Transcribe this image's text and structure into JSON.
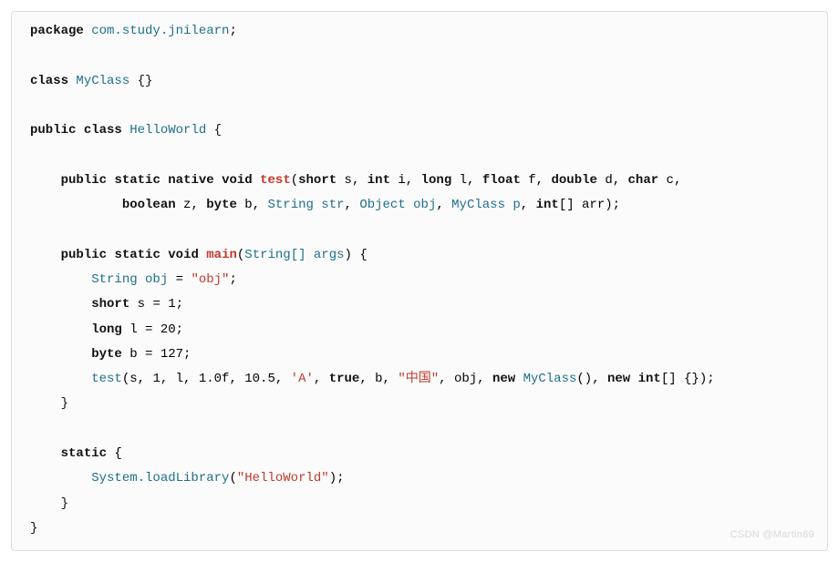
{
  "code": {
    "l1_kw1": "package",
    "l1_pkg": "com.study.jnilearn",
    "l1_semi": ";",
    "l3_kw1": "class",
    "l3_name": "MyClass",
    "l3_braces": "{}",
    "l5_kw1": "public",
    "l5_kw2": "class",
    "l5_name": "HelloWorld",
    "l5_ob": "{",
    "l7_ind": "    ",
    "l7_kw1": "public",
    "l7_kw2": "static",
    "l7_kw3": "native",
    "l7_kw4": "void",
    "l7_fn": "test",
    "l7_op": "(",
    "l7_t1": "short",
    "l7_v1": "s",
    "l7_c1": ", ",
    "l7_t2": "int",
    "l7_v2": "i",
    "l7_c2": ", ",
    "l7_t3": "long",
    "l7_v3": "l",
    "l7_c3": ", ",
    "l7_t4": "float",
    "l7_v4": "f",
    "l7_c4": ", ",
    "l7_t5": "double",
    "l7_v5": "d",
    "l7_c5": ", ",
    "l7_t6": "char",
    "l7_v6": "c",
    "l7_c6": ",",
    "l8_ind": "            ",
    "l8_t1": "boolean",
    "l8_v1": "z",
    "l8_c1": ", ",
    "l8_t2": "byte",
    "l8_v2": "b",
    "l8_c2": ", ",
    "l8_t3": "String str",
    "l8_c3": ", ",
    "l8_t4": "Object obj",
    "l8_c4": ", ",
    "l8_t5": "MyClass p",
    "l8_c5": ", ",
    "l8_t6": "int",
    "l8_arr": "[] arr",
    "l8_cp": ");",
    "l10_ind": "    ",
    "l10_kw1": "public",
    "l10_kw2": "static",
    "l10_kw3": "void",
    "l10_fn": "main",
    "l10_op": "(",
    "l10_arg": "String[] args",
    "l10_cp": ") {",
    "l11_ind": "        ",
    "l11_type": "String obj",
    "l11_eq": " = ",
    "l11_str": "\"obj\"",
    "l11_semi": ";",
    "l12_ind": "        ",
    "l12_kw": "short",
    "l12_v": " s = 1;",
    "l13_ind": "        ",
    "l13_kw": "long",
    "l13_v": " l = 20;",
    "l14_ind": "        ",
    "l14_kw": "byte",
    "l14_v": " b = 127;",
    "l15_ind": "        ",
    "l15_call": "test",
    "l15_op": "(",
    "l15_a1": "s, 1, l, 1.0f, 10.5, ",
    "l15_char": "'A'",
    "l15_c1": ", ",
    "l15_true": "true",
    "l15_c2": ", b, ",
    "l15_str": "\"中国\"",
    "l15_c3": ", obj, ",
    "l15_new1": "new",
    "l15_mc": " MyClass",
    "l15_mcp": "(), ",
    "l15_new2": "new",
    "l15_int": " int",
    "l15_tail": "[] {});",
    "l16_ind": "    ",
    "l16_cb": "}",
    "l18_ind": "    ",
    "l18_kw": "static",
    "l18_ob": " {",
    "l19_ind": "        ",
    "l19_call": "System.loadLibrary",
    "l19_op": "(",
    "l19_str": "\"HelloWorld\"",
    "l19_cp": ");",
    "l20_ind": "    ",
    "l20_cb": "}",
    "l21_cb": "}"
  },
  "watermark": "CSDN @Martin89",
  "watermark_bg": ""
}
